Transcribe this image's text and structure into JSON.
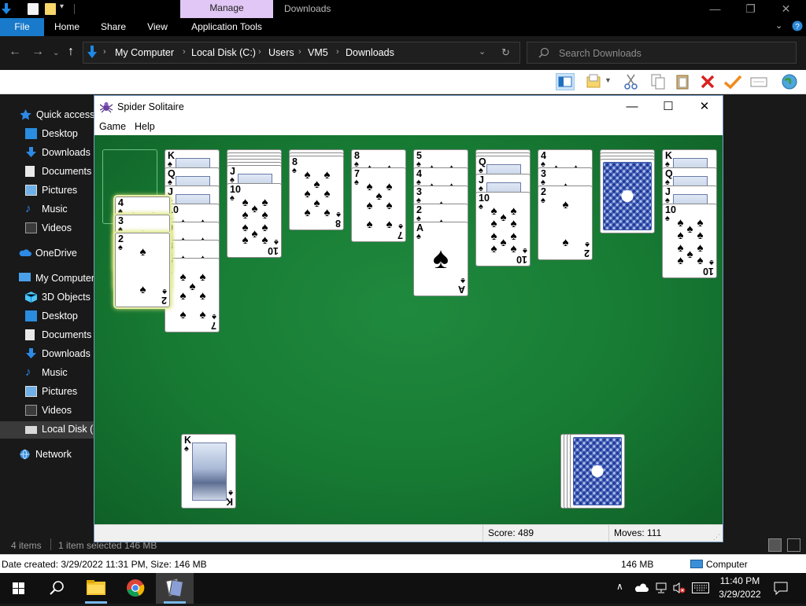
{
  "explorer": {
    "title": "Downloads",
    "manage_tab": "Manage",
    "window_controls": {
      "minimize": "—",
      "maximize": "❐",
      "close": "✕"
    },
    "ribbon_tabs": [
      "File",
      "Home",
      "Share",
      "View",
      "Application Tools"
    ],
    "breadcrumb": [
      "My Computer",
      "Local Disk (C:)",
      "Users",
      "VM5",
      "Downloads"
    ],
    "search_placeholder": "Search Downloads",
    "nav_items": [
      {
        "label": "Quick access",
        "icon": "star-icon"
      },
      {
        "label": "Desktop",
        "icon": "desktop-icon"
      },
      {
        "label": "Downloads",
        "icon": "download-icon"
      },
      {
        "label": "Documents",
        "icon": "document-icon"
      },
      {
        "label": "Pictures",
        "icon": "pictures-icon"
      },
      {
        "label": "Music",
        "icon": "music-icon"
      },
      {
        "label": "Videos",
        "icon": "videos-icon"
      },
      {
        "label": "OneDrive",
        "icon": "cloud-icon"
      },
      {
        "label": "My Computer",
        "icon": "computer-icon"
      },
      {
        "label": "3D Objects",
        "icon": "cube-icon"
      },
      {
        "label": "Desktop",
        "icon": "desktop-icon"
      },
      {
        "label": "Documents",
        "icon": "document-icon"
      },
      {
        "label": "Downloads",
        "icon": "download-icon"
      },
      {
        "label": "Music",
        "icon": "music-icon"
      },
      {
        "label": "Pictures",
        "icon": "pictures-icon"
      },
      {
        "label": "Videos",
        "icon": "videos-icon"
      },
      {
        "label": "Local Disk (C",
        "icon": "drive-icon"
      },
      {
        "label": "Network",
        "icon": "network-icon"
      }
    ],
    "status": {
      "items": "4 items",
      "selected": "1 item selected",
      "size": "146 MB"
    },
    "details": {
      "created": "Date created: 3/29/2022 11:31 PM, Size: 146 MB",
      "size": "146 MB",
      "location": "Computer"
    }
  },
  "solitaire": {
    "title": "Spider Solitaire",
    "window_controls": {
      "minimize": "—",
      "maximize": "☐",
      "close": "✕"
    },
    "menu": [
      "Game",
      "Help"
    ],
    "score_label": "Score: 489",
    "moves_label": "Moves:  111",
    "columns": [
      {
        "faceup": [],
        "empty": true
      },
      {
        "backs": 0,
        "faceup": [
          "K",
          "Q",
          "J",
          "10",
          "9",
          "8",
          "7"
        ]
      },
      {
        "backs": 5,
        "faceup": [
          "J",
          "10"
        ]
      },
      {
        "backs": 2,
        "faceup": [
          "8"
        ]
      },
      {
        "backs": 0,
        "faceup": [
          "8",
          "7"
        ]
      },
      {
        "backs": 0,
        "faceup": [
          "5",
          "4",
          "3",
          "2",
          "A"
        ]
      },
      {
        "backs": 2,
        "faceup": [
          "Q",
          "J",
          "10"
        ]
      },
      {
        "backs": 0,
        "faceup": [
          "4",
          "3",
          "2"
        ]
      },
      {
        "backs": 4,
        "faceup": []
      },
      {
        "backs": 0,
        "faceup": [
          "K",
          "Q",
          "J",
          "10"
        ]
      }
    ],
    "dragging": [
      "4",
      "3",
      "2"
    ],
    "completed_suit": "K",
    "stock_stacks": 4,
    "suit_symbol": "♠"
  },
  "taskbar": {
    "time": "11:40 PM",
    "date": "3/29/2022",
    "apps": [
      "start-icon",
      "search-icon",
      "file-explorer-icon",
      "chrome-icon",
      "spider-solitaire-icon"
    ]
  }
}
